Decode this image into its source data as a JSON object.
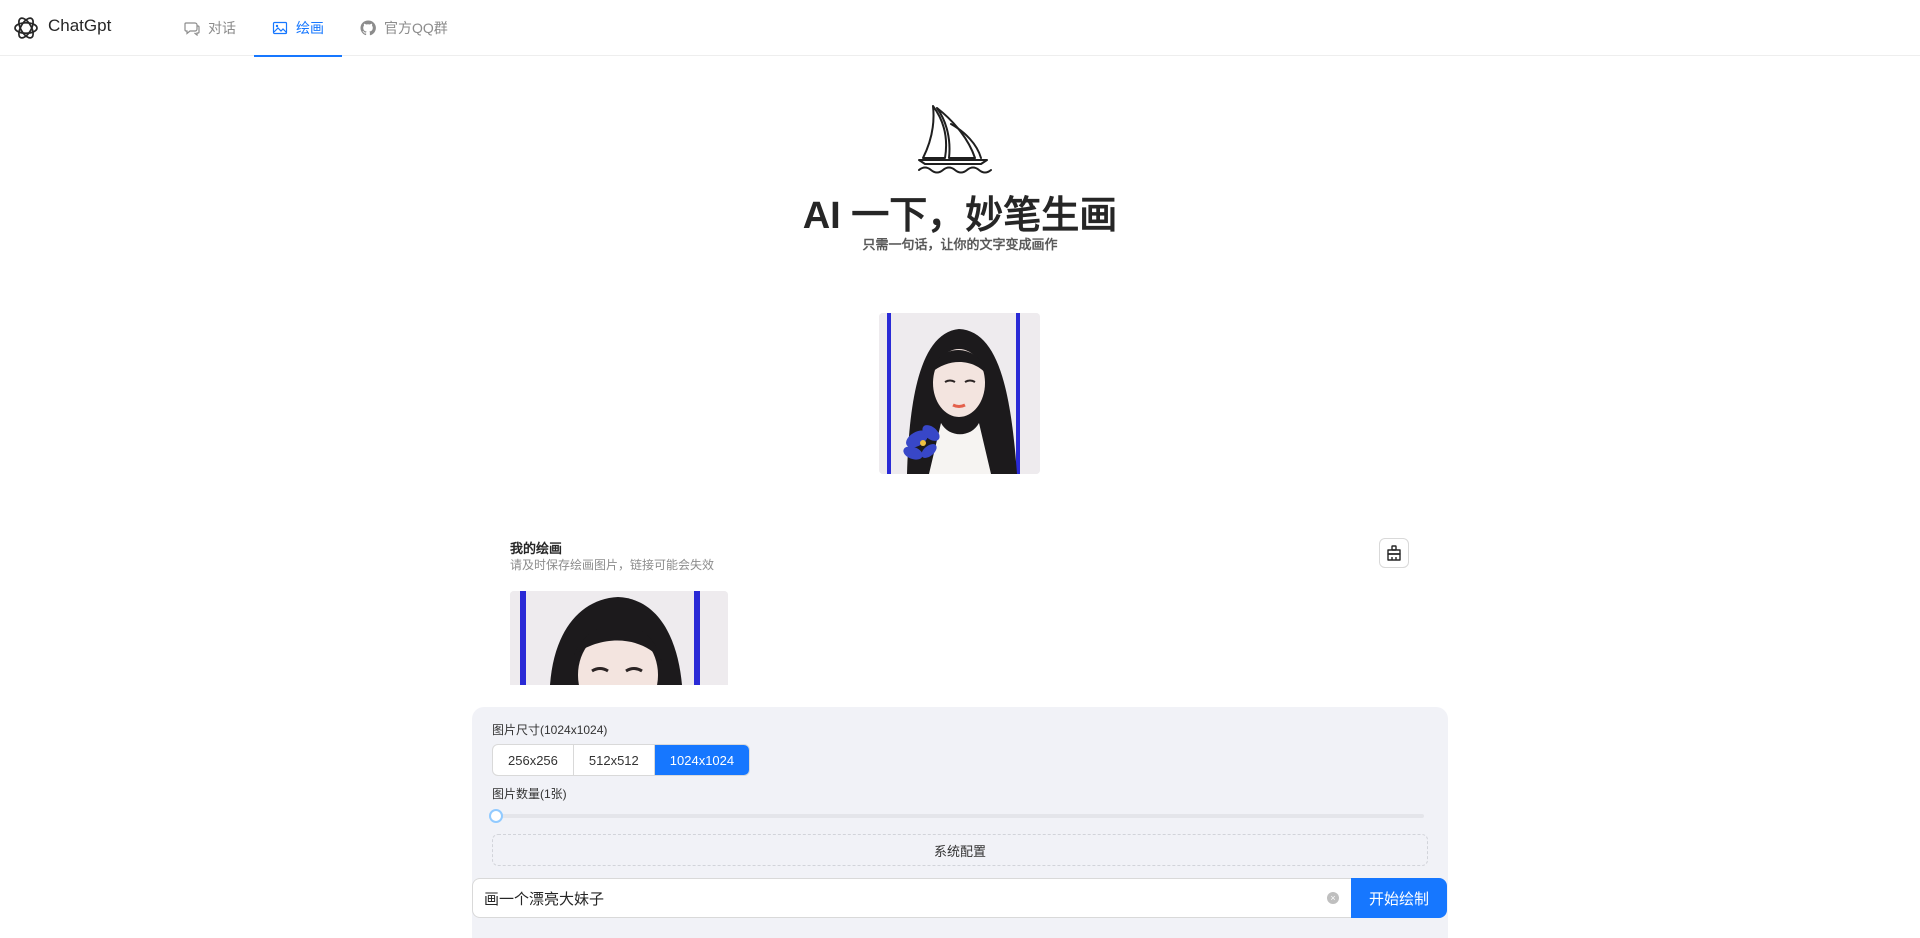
{
  "header": {
    "brand": "ChatGpt",
    "nav": [
      {
        "label": "对话",
        "icon": "chat-bubble-icon",
        "active": false
      },
      {
        "label": "绘画",
        "icon": "picture-icon",
        "active": true
      },
      {
        "label": "官方QQ群",
        "icon": "github-icon",
        "active": false
      }
    ]
  },
  "hero": {
    "title": "AI 一下，妙笔生画",
    "subtitle": "只需一句话，让你的文字变成画作"
  },
  "mine": {
    "title": "我的绘画",
    "subtitle": "请及时保存绘画图片，链接可能会失效"
  },
  "panel": {
    "size_label": "图片尺寸(1024x1024)",
    "sizes": [
      "256x256",
      "512x512",
      "1024x1024"
    ],
    "selected_size": "1024x1024",
    "count_label": "图片数量(1张)",
    "count_value": 1,
    "count_min": 1,
    "count_max": 10,
    "system_config": "系统配置",
    "prompt_value": "画一个漂亮大妹子",
    "submit": "开始绘制"
  },
  "colors": {
    "accent": "#1677ff",
    "panel_bg": "#f1f2f7"
  }
}
